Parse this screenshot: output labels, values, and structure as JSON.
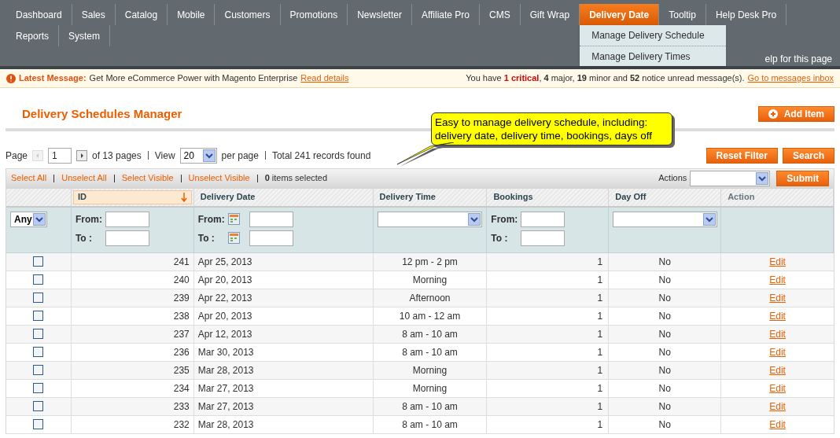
{
  "nav": {
    "items": [
      {
        "label": "Dashboard",
        "selected": false
      },
      {
        "label": "Sales",
        "selected": false
      },
      {
        "label": "Catalog",
        "selected": false
      },
      {
        "label": "Mobile",
        "selected": false
      },
      {
        "label": "Customers",
        "selected": false
      },
      {
        "label": "Promotions",
        "selected": false
      },
      {
        "label": "Newsletter",
        "selected": false
      },
      {
        "label": "Affiliate Pro",
        "selected": false
      },
      {
        "label": "CMS",
        "selected": false
      },
      {
        "label": "Gift Wrap",
        "selected": false
      },
      {
        "label": "Delivery Date",
        "selected": true,
        "expanded": true,
        "children": [
          "Manage Delivery Schedule",
          "Manage Delivery Times"
        ]
      },
      {
        "label": "Tooltip",
        "selected": false
      },
      {
        "label": "Help Desk Pro",
        "selected": false
      },
      {
        "label": "Reports",
        "selected": false
      },
      {
        "label": "System",
        "selected": false
      }
    ],
    "help_link": "elp for this page"
  },
  "message": {
    "label": "Latest Message:",
    "text": "Get More eCommerce Power with Magento Enterprise",
    "link": "Read details",
    "summary": "You have **1 critical**, **4** major, **19** minor and **52** notice unread message(s).",
    "inbox_link": "Go to messages inbox"
  },
  "title": "Delivery Schedules Manager",
  "add_button": "Add Item",
  "callout": "Easy to manage delivery schedule, including: delivery date, delivery time, bookings, days off",
  "pager": {
    "page_label": "Page",
    "page": "1",
    "of_pages": "of 13 pages",
    "view_label": "View",
    "per_page": "20",
    "per_page_label": "per page",
    "total": "Total 241 records found"
  },
  "filter_buttons": [
    "Reset Filter",
    "Search"
  ],
  "massaction": {
    "links": [
      "Select All",
      "Unselect All",
      "Select Visible",
      "Unselect Visible"
    ],
    "selected_count": "0",
    "selected_label": "items selected",
    "actions_label": "Actions",
    "submit": "Submit"
  },
  "table": {
    "columns": [
      {
        "label": "ID",
        "sorted": true
      },
      {
        "label": "Delivery Date",
        "sorted": false
      },
      {
        "label": "Delivery Time",
        "sorted": false
      },
      {
        "label": "Bookings",
        "sorted": false
      },
      {
        "label": "Day Off",
        "sorted": false
      },
      {
        "label": "Action",
        "sorted": false
      }
    ],
    "filters": {
      "select_value": "Any",
      "ranges": [
        {
          "from": "From:",
          "to": "To :"
        },
        {
          "from": "From:",
          "to": "To :"
        },
        {
          "from": "From:",
          "to": "To :"
        }
      ]
    },
    "rows": [
      {
        "checked": false,
        "id": "241",
        "date": "Apr 25, 2013",
        "time": "12 pm - 2 pm",
        "bookings": "1",
        "day_off": "No",
        "action": "Edit"
      },
      {
        "checked": false,
        "id": "240",
        "date": "Apr 20, 2013",
        "time": "Morning",
        "bookings": "1",
        "day_off": "No",
        "action": "Edit"
      },
      {
        "checked": false,
        "id": "239",
        "date": "Apr 22, 2013",
        "time": "Afternoon",
        "bookings": "1",
        "day_off": "No",
        "action": "Edit"
      },
      {
        "checked": false,
        "id": "238",
        "date": "Apr 20, 2013",
        "time": "10 am - 12 am",
        "bookings": "1",
        "day_off": "No",
        "action": "Edit"
      },
      {
        "checked": false,
        "id": "237",
        "date": "Apr 12, 2013",
        "time": "8 am - 10 am",
        "bookings": "1",
        "day_off": "No",
        "action": "Edit"
      },
      {
        "checked": false,
        "id": "236",
        "date": "Mar 30, 2013",
        "time": "8 am - 10 am",
        "bookings": "1",
        "day_off": "No",
        "action": "Edit"
      },
      {
        "checked": false,
        "id": "235",
        "date": "Mar 28, 2013",
        "time": "Morning",
        "bookings": "1",
        "day_off": "No",
        "action": "Edit"
      },
      {
        "checked": false,
        "id": "234",
        "date": "Mar 27, 2013",
        "time": "Morning",
        "bookings": "1",
        "day_off": "No",
        "action": "Edit"
      },
      {
        "checked": false,
        "id": "233",
        "date": "Mar 27, 2013",
        "time": "8 am - 10 am",
        "bookings": "1",
        "day_off": "No",
        "action": "Edit"
      },
      {
        "checked": false,
        "id": "232",
        "date": "Mar 28, 2013",
        "time": "8 am - 10 am",
        "bookings": "1",
        "day_off": "No",
        "action": "Edit"
      }
    ]
  }
}
